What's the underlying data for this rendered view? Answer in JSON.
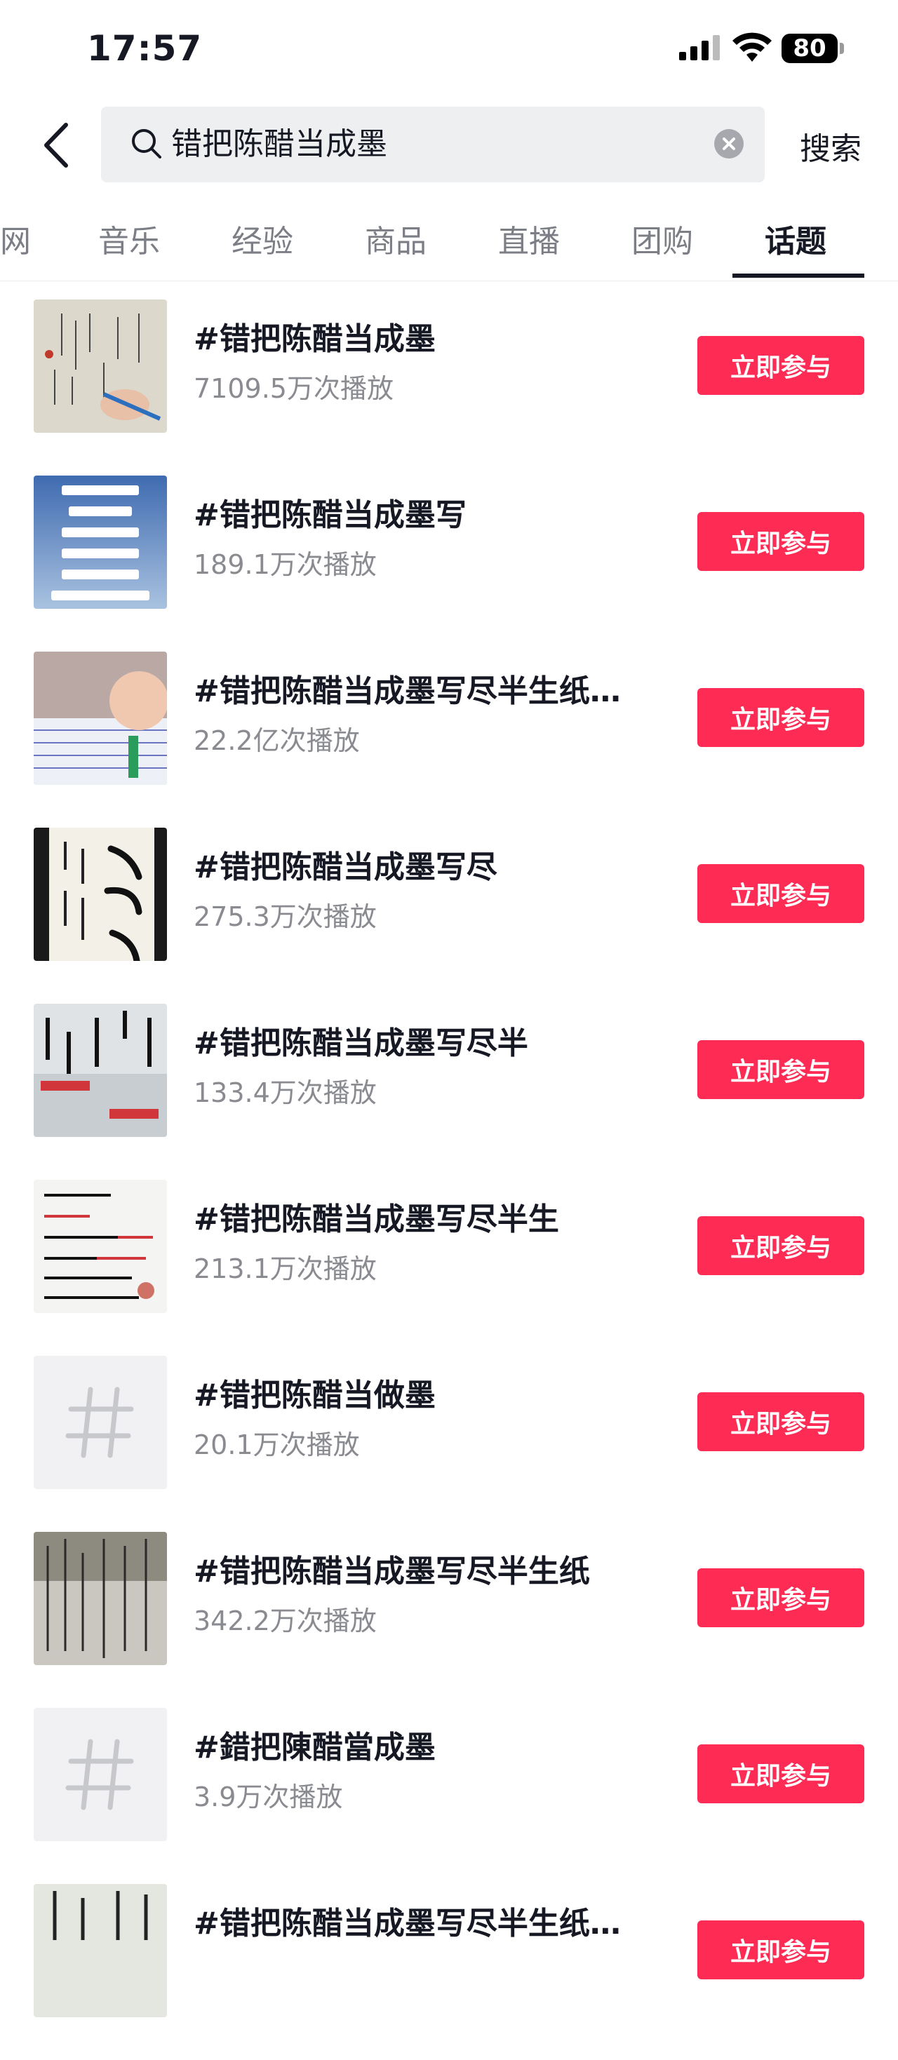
{
  "status_bar": {
    "time": "17:57",
    "battery": "80"
  },
  "search": {
    "query": "错把陈醋当成墨",
    "button_label": "搜索"
  },
  "tabs": [
    "网",
    "音乐",
    "经验",
    "商品",
    "直播",
    "团购",
    "话题"
  ],
  "active_tab": "话题",
  "topics": [
    {
      "title": "#错把陈醋当成墨",
      "plays": "7109.5万次播放",
      "join": "立即参与",
      "thumb": "calligraphy-photo"
    },
    {
      "title": "#错把陈醋当成墨写",
      "plays": "189.1万次播放",
      "join": "立即参与",
      "thumb": "poem-text"
    },
    {
      "title": "#错把陈醋当成墨写尽半生纸…",
      "plays": "22.2亿次播放",
      "join": "立即参与",
      "thumb": "selfie-notebook"
    },
    {
      "title": "#错把陈醋当成墨写尽",
      "plays": "275.3万次播放",
      "join": "立即参与",
      "thumb": "brush-calligraphy"
    },
    {
      "title": "#错把陈醋当成墨写尽半",
      "plays": "133.4万次播放",
      "join": "立即参与",
      "thumb": "quote-card"
    },
    {
      "title": "#错把陈醋当成墨写尽半生",
      "plays": "213.1万次播放",
      "join": "立即参与",
      "thumb": "handwritten-card"
    },
    {
      "title": "#错把陈醋当做墨",
      "plays": "20.1万次播放",
      "join": "立即参与",
      "thumb": "hash-placeholder"
    },
    {
      "title": "#错把陈醋当成墨写尽半生纸",
      "plays": "342.2万次播放",
      "join": "立即参与",
      "thumb": "script-paper"
    },
    {
      "title": "#錯把陳醋當成墨",
      "plays": "3.9万次播放",
      "join": "立即参与",
      "thumb": "hash-placeholder"
    },
    {
      "title": "#错把陈醋当成墨写尽半生纸…",
      "plays": "",
      "join": "立即参与",
      "thumb": "calligraphy-partial"
    }
  ],
  "colors": {
    "accent": "#fe2c55",
    "text": "#161823",
    "muted": "#8a8b91"
  }
}
